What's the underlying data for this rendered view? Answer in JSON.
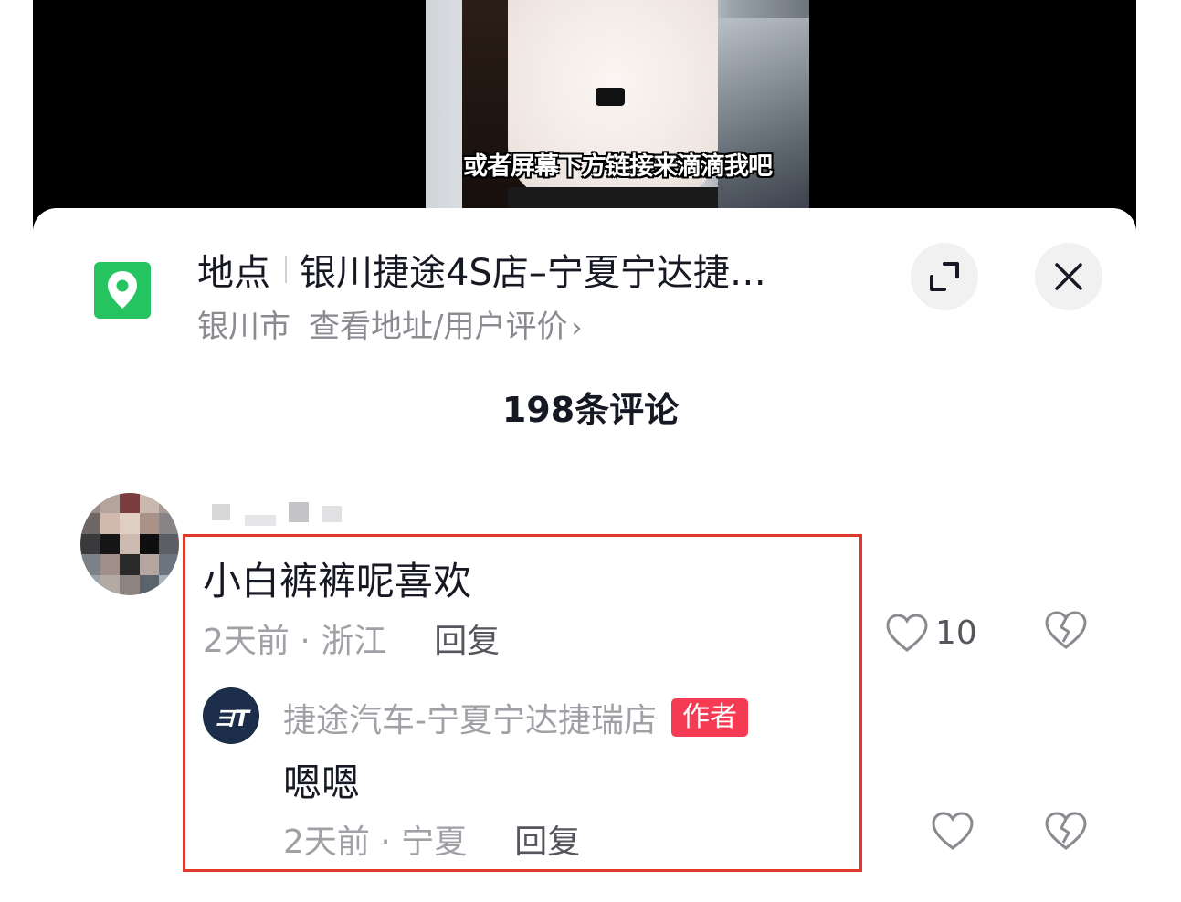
{
  "video": {
    "caption": "或者屏幕下方链接来滴滴我吧"
  },
  "location": {
    "label": "地点",
    "name": "银川捷途4S店–宁夏宁达捷…",
    "city": "银川市",
    "link": "查看地址/用户评价",
    "chevron": "›",
    "icon": "map-pin-icon",
    "icon_color": "#25c460"
  },
  "comments_header": {
    "count_text": "198条评论"
  },
  "comment": {
    "text": "小白裤裤呢喜欢",
    "meta": "2天前 · 浙江",
    "reply_label": "回复",
    "like_count": "10",
    "highlight_color": "#e0392b"
  },
  "reply": {
    "avatar_text": "ヨT",
    "author": "捷途汽车-宁夏宁达捷瑞店",
    "badge": "作者",
    "badge_color": "#f43b53",
    "text": "嗯嗯",
    "meta": "2天前 · 宁夏",
    "reply_label": "回复"
  }
}
